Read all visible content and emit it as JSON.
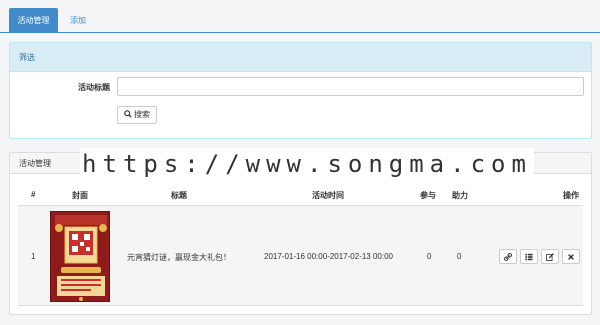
{
  "tabs": [
    {
      "label": "活动管理",
      "active": true
    },
    {
      "label": "添加",
      "active": false
    }
  ],
  "filter": {
    "heading": "筛选",
    "title_label": "活动标题",
    "title_value": "",
    "search_button": "搜索"
  },
  "list": {
    "heading": "活动管理",
    "columns": [
      "#",
      "封面",
      "标题",
      "活动时间",
      "参与",
      "助力",
      "操作"
    ],
    "rows": [
      {
        "index": "1",
        "title": "元宵猜灯谜，赢现金大礼包！",
        "time": "2017-01-16 00:00-2017-02-13 00:00",
        "participants": "0",
        "boosts": "0"
      }
    ],
    "actions": [
      "link-icon",
      "list-icon",
      "edit-icon",
      "close-icon"
    ]
  },
  "watermark": "https://www.songma.com",
  "colors": {
    "primary": "#428bca",
    "filter_head_bg": "#d9edf7",
    "filter_head_text": "#31708f",
    "cover_red": "#8f1c1a",
    "cover_gold": "#e8b64a"
  }
}
